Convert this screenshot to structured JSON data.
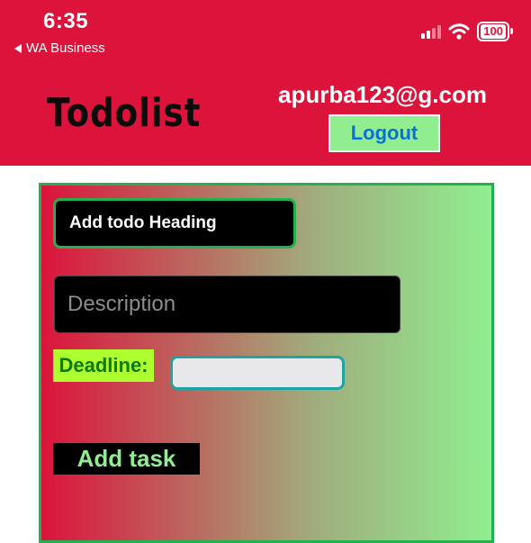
{
  "status_bar": {
    "time": "6:35",
    "back_label": "WA Business",
    "battery": "100"
  },
  "header": {
    "app_title": "Todolist",
    "user_email": "apurba123@g.com",
    "logout_label": "Logout"
  },
  "form": {
    "heading_value": "Add todo Heading",
    "description_placeholder": "Description",
    "deadline_label": "Deadline:",
    "deadline_value": "",
    "add_task_label": "Add task"
  },
  "colors": {
    "header_bg": "#dc143c",
    "logout_bg": "#90ee90",
    "panel_border": "#22b14c",
    "deadline_label_bg": "#adff2f"
  },
  "icons": [
    "back-arrow-icon",
    "cellular-signal-icon",
    "wifi-icon",
    "battery-icon"
  ]
}
